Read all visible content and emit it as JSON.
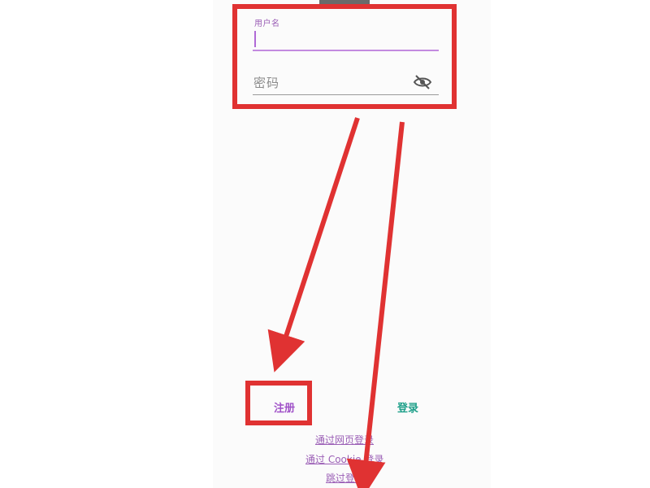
{
  "form": {
    "username_label": "用户名",
    "password_placeholder": "密码"
  },
  "actions": {
    "register_label": "注册",
    "login_label": "登录"
  },
  "links": {
    "web_login": "通过网页登录",
    "cookie_login": "通过 Cookie 登录",
    "skip_login": "跳过登录"
  },
  "colors": {
    "accent_purple": "#a052c8",
    "accent_green": "#1fa08a",
    "annotation_red": "#e03232"
  },
  "icons": {
    "password_visibility": "eye-off-icon"
  }
}
